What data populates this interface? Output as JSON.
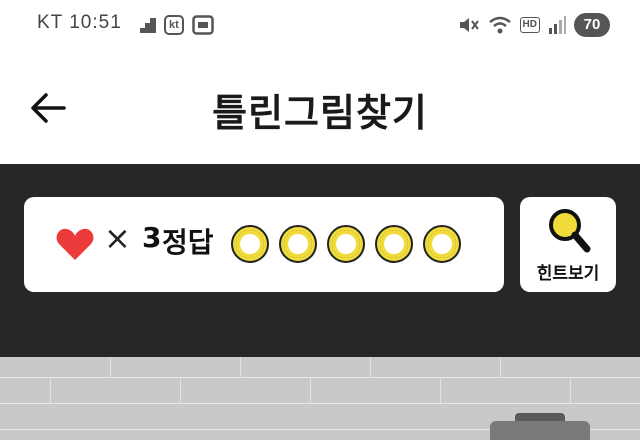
{
  "status_bar": {
    "carrier_time": "KT 10:51",
    "kt_badge": "kt",
    "hd_badge": "HD",
    "battery": "70"
  },
  "header": {
    "title": "틀린그림찾기"
  },
  "score": {
    "times": "×",
    "lives": "3",
    "answer_label": "정답",
    "answers_total": 5,
    "answers_found": 0
  },
  "hint": {
    "label": "힌트보기"
  },
  "colors": {
    "heart": "#ec3b3b",
    "circle_accent": "#f1db3a",
    "panel_bg": "#272727"
  }
}
